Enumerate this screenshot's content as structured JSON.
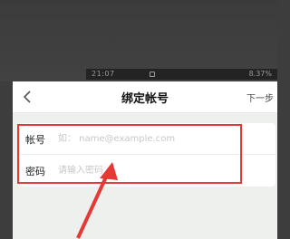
{
  "status_bar": {
    "time": "21:07",
    "indicators": "⊙⊙",
    "battery": "8.37%"
  },
  "nav": {
    "back_icon": "chevron-left-icon",
    "title": "绑定帐号",
    "next_label": "下一步"
  },
  "form": {
    "account": {
      "label": "帐号",
      "placeholder": "如： name@example.com",
      "value": ""
    },
    "password": {
      "label": "密码",
      "placeholder": "请输入密码",
      "value": ""
    }
  },
  "annotation": {
    "highlight_color": "#e53935",
    "arrow_color": "#e53935"
  }
}
